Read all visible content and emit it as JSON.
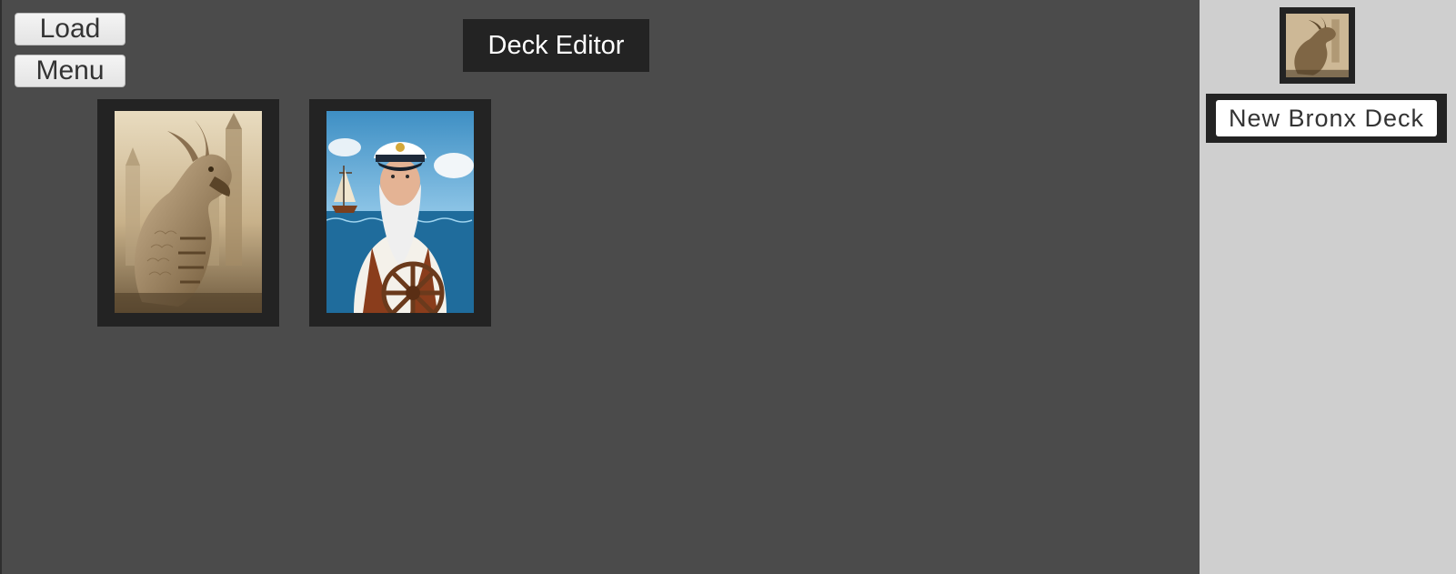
{
  "toolbar": {
    "load_label": "Load",
    "menu_label": "Menu"
  },
  "header": {
    "title": "Deck Editor"
  },
  "cards": [
    {
      "name": "dragon-card",
      "icon": "dragon-illustration"
    },
    {
      "name": "captain-card",
      "icon": "sea-captain-illustration"
    }
  ],
  "side_panel": {
    "deck_thumbnail_icon": "dragon-illustration",
    "deck_name": "New Bronx Deck"
  },
  "colors": {
    "main_background": "#4b4b4b",
    "side_panel_background": "#cfcfcf",
    "frame_dark": "#232323",
    "button_background": "#ececec",
    "title_text": "#ffffff"
  }
}
